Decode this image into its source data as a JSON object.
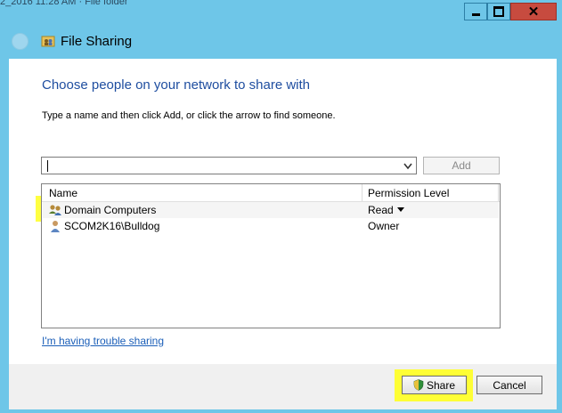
{
  "window": {
    "top_title_fragment": "2_2016 11:28 AM  ·  File folder",
    "title": "File Sharing",
    "close_glyph": "✕"
  },
  "dialog": {
    "heading": "Choose people on your network to share with",
    "instruction": "Type a name and then click Add, or click the arrow to find someone.",
    "name_input": {
      "value": "",
      "placeholder": ""
    },
    "add_label": "Add",
    "columns": [
      "Name",
      "Permission Level"
    ],
    "rows": [
      {
        "name": "Domain Computers",
        "permission": "Read",
        "icon": "group-users-icon",
        "has_dropdown": true
      },
      {
        "name": "SCOM2K16\\Bulldog",
        "permission": "Owner",
        "icon": "user-icon",
        "has_dropdown": false
      }
    ],
    "trouble_link": "I'm having trouble sharing",
    "share_label": "Share",
    "cancel_label": "Cancel"
  },
  "colors": {
    "title_bar": "#6ec6e8",
    "heading": "#1f4ea0",
    "highlight": "#ffff20",
    "link": "#1a5eb8"
  }
}
